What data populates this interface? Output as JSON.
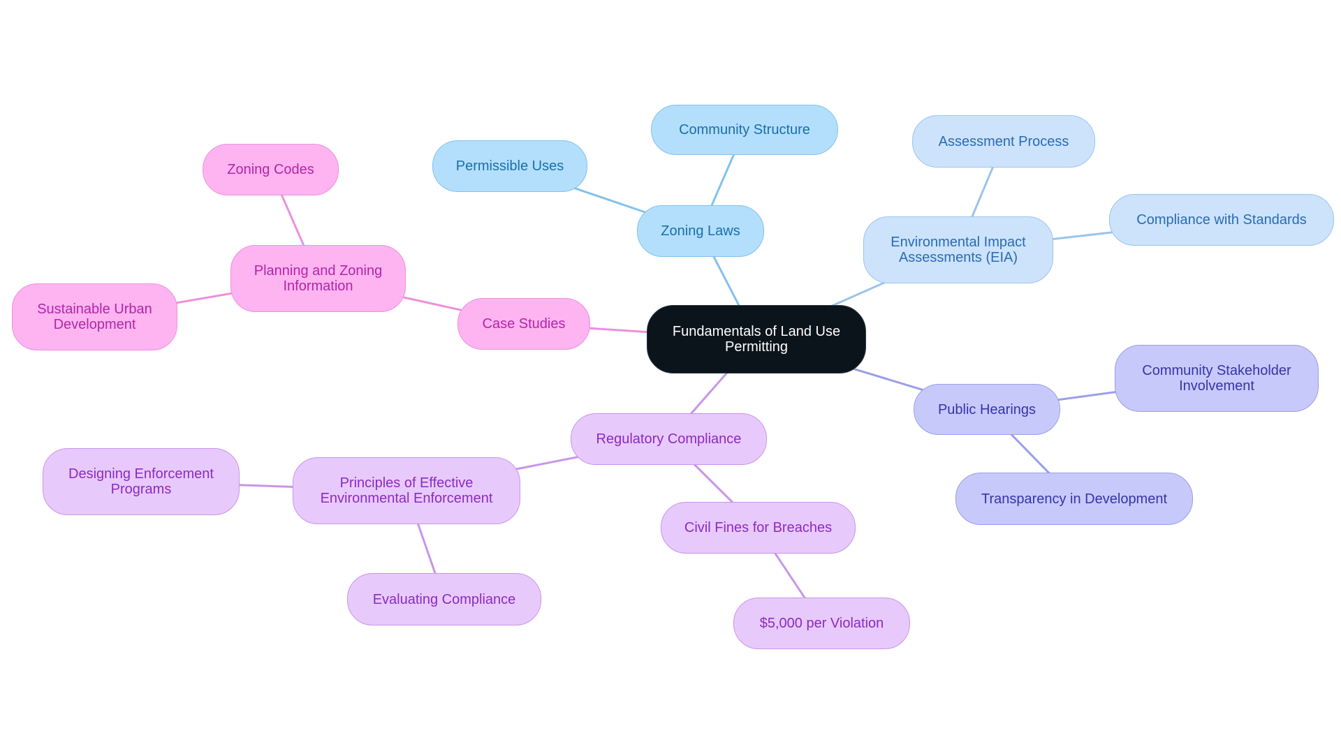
{
  "title": "Fundamentals of Land Use Permitting",
  "colors": {
    "root": "#0c141b",
    "zoning": "#84c1ec",
    "eia": "#9cc3ec",
    "hearings": "#9a9ee8",
    "case": "#ec8fde",
    "regulatory": "#c895ea"
  },
  "nodes": {
    "root": {
      "label": "Fundamentals of Land Use\nPermitting"
    },
    "zoning_laws": {
      "label": "Zoning Laws"
    },
    "community_structure": {
      "label": "Community Structure"
    },
    "permissible_uses": {
      "label": "Permissible Uses"
    },
    "eia": {
      "label": "Environmental Impact\nAssessments (EIA)"
    },
    "assessment_process": {
      "label": "Assessment Process"
    },
    "compliance_standards": {
      "label": "Compliance with Standards"
    },
    "public_hearings": {
      "label": "Public Hearings"
    },
    "stakeholder": {
      "label": "Community Stakeholder\nInvolvement"
    },
    "transparency": {
      "label": "Transparency in Development"
    },
    "case_studies": {
      "label": "Case Studies"
    },
    "planning_zoning": {
      "label": "Planning and Zoning\nInformation"
    },
    "zoning_codes": {
      "label": "Zoning Codes"
    },
    "sustainable": {
      "label": "Sustainable Urban\nDevelopment"
    },
    "regulatory": {
      "label": "Regulatory Compliance"
    },
    "principles": {
      "label": "Principles of Effective\nEnvironmental Enforcement"
    },
    "designing": {
      "label": "Designing Enforcement\nPrograms"
    },
    "evaluating": {
      "label": "Evaluating Compliance"
    },
    "civil_fines": {
      "label": "Civil Fines for Breaches"
    },
    "five_thousand": {
      "label": "$5,000 per Violation"
    }
  },
  "edges": [
    [
      "root",
      "zoning_laws",
      "zoning"
    ],
    [
      "zoning_laws",
      "community_structure",
      "zoning"
    ],
    [
      "zoning_laws",
      "permissible_uses",
      "zoning"
    ],
    [
      "root",
      "eia",
      "eia"
    ],
    [
      "eia",
      "assessment_process",
      "eia"
    ],
    [
      "eia",
      "compliance_standards",
      "eia"
    ],
    [
      "root",
      "public_hearings",
      "hearings"
    ],
    [
      "public_hearings",
      "stakeholder",
      "hearings"
    ],
    [
      "public_hearings",
      "transparency",
      "hearings"
    ],
    [
      "root",
      "case_studies",
      "case"
    ],
    [
      "case_studies",
      "planning_zoning",
      "case"
    ],
    [
      "planning_zoning",
      "zoning_codes",
      "case"
    ],
    [
      "planning_zoning",
      "sustainable",
      "case"
    ],
    [
      "root",
      "regulatory",
      "regulatory"
    ],
    [
      "regulatory",
      "principles",
      "regulatory"
    ],
    [
      "principles",
      "designing",
      "regulatory"
    ],
    [
      "principles",
      "evaluating",
      "regulatory"
    ],
    [
      "regulatory",
      "civil_fines",
      "regulatory"
    ],
    [
      "civil_fines",
      "five_thousand",
      "regulatory"
    ]
  ]
}
